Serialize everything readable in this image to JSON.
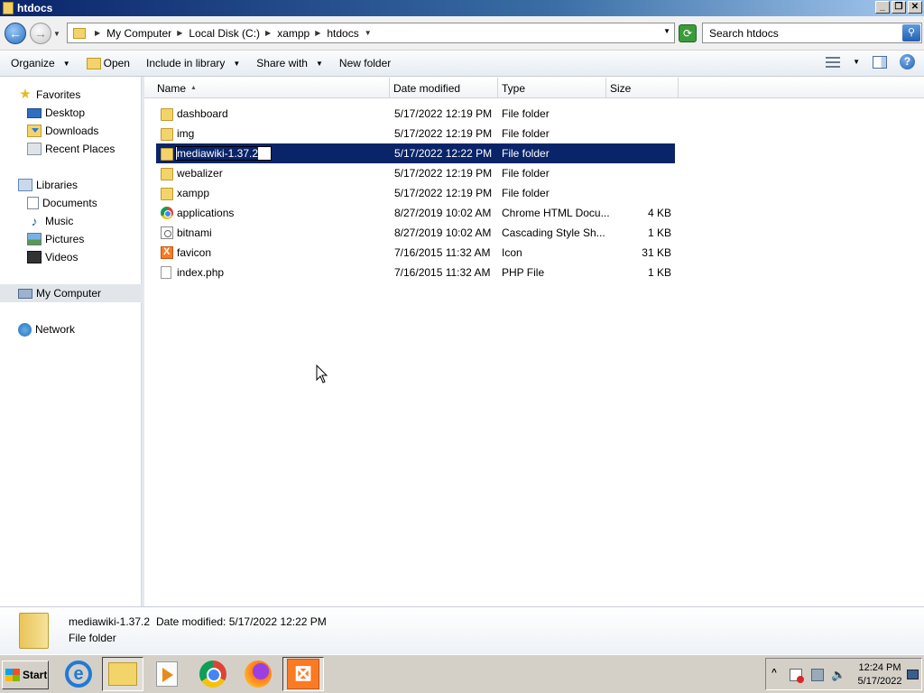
{
  "window": {
    "title": "htdocs"
  },
  "address": {
    "crumbs": [
      "My Computer",
      "Local Disk (C:)",
      "xampp",
      "htdocs"
    ],
    "search_placeholder": "Search htdocs"
  },
  "toolbar": {
    "organize": "Organize",
    "open": "Open",
    "include_in_library": "Include in library",
    "share_with": "Share with",
    "new_folder": "New folder"
  },
  "nav": {
    "favorites": "Favorites",
    "desktop": "Desktop",
    "downloads": "Downloads",
    "recent_places": "Recent Places",
    "libraries": "Libraries",
    "documents": "Documents",
    "music": "Music",
    "pictures": "Pictures",
    "videos": "Videos",
    "my_computer": "My Computer",
    "network": "Network"
  },
  "columns": {
    "name": "Name",
    "date_modified": "Date modified",
    "type": "Type",
    "size": "Size"
  },
  "files": [
    {
      "name": "dashboard",
      "date": "5/17/2022 12:19 PM",
      "type": "File folder",
      "size": "",
      "icon": "folder-icon"
    },
    {
      "name": "img",
      "date": "5/17/2022 12:19 PM",
      "type": "File folder",
      "size": "",
      "icon": "folder-icon"
    },
    {
      "name": "mediawiki-1.37.2",
      "date": "5/17/2022 12:22 PM",
      "type": "File folder",
      "size": "",
      "icon": "folder-icon",
      "selected": true,
      "renaming": true
    },
    {
      "name": "webalizer",
      "date": "5/17/2022 12:19 PM",
      "type": "File folder",
      "size": "",
      "icon": "folder-icon"
    },
    {
      "name": "xampp",
      "date": "5/17/2022 12:19 PM",
      "type": "File folder",
      "size": "",
      "icon": "folder-icon"
    },
    {
      "name": "applications",
      "date": "8/27/2019 10:02 AM",
      "type": "Chrome HTML Docu...",
      "size": "4 KB",
      "icon": "chrome-html-icon"
    },
    {
      "name": "bitnami",
      "date": "8/27/2019 10:02 AM",
      "type": "Cascading Style Sh...",
      "size": "1 KB",
      "icon": "css-file-icon"
    },
    {
      "name": "favicon",
      "date": "7/16/2015 11:32 AM",
      "type": "Icon",
      "size": "31 KB",
      "icon": "xampp-ico-icon"
    },
    {
      "name": "index.php",
      "date": "7/16/2015 11:32 AM",
      "type": "PHP File",
      "size": "1 KB",
      "icon": "php-file-icon"
    }
  ],
  "details": {
    "name": "mediawiki-1.37.2",
    "date_label": "Date modified:",
    "date": "5/17/2022 12:22 PM",
    "type": "File folder"
  },
  "taskbar": {
    "start": "Start",
    "apps": [
      "internet-explorer-icon",
      "windows-explorer-icon",
      "media-player-icon",
      "chrome-icon",
      "firefox-icon",
      "xampp-icon"
    ],
    "time": "12:24 PM",
    "date": "5/17/2022"
  },
  "colors": {
    "selection": "#0a246a",
    "title_bar": "#0a246a",
    "taskbar": "#d4d0c8"
  }
}
